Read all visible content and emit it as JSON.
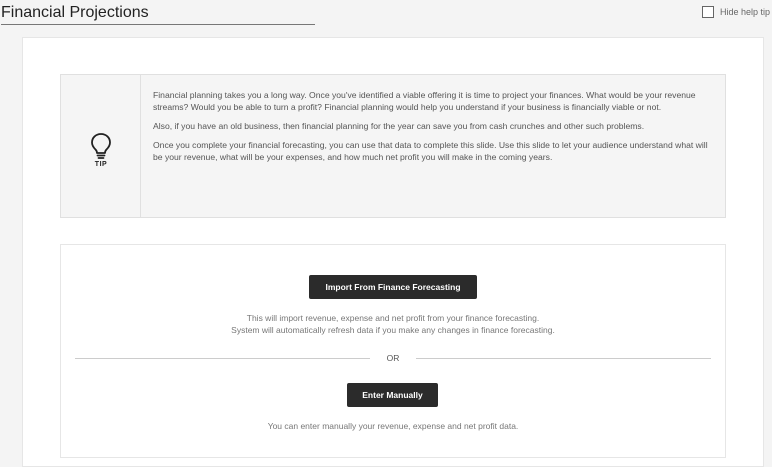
{
  "header": {
    "title": "Financial Projections",
    "help_toggle_label": "Hide help tip",
    "help_toggle_checked": false
  },
  "tip": {
    "label": "TIP",
    "icon": "lightbulb-icon",
    "paragraphs": [
      "Financial planning takes you a long way. Once you've identified a viable offering it is time to project your finances. What would be your revenue streams? Would you be able to turn a profit? Financial planning would help you understand if your business is financially viable or not.",
      "Also, if you have an old business, then financial planning for the year can save you from cash crunches and other such problems.",
      "Once you complete your financial forecasting, you can use that data to complete this slide. Use this slide to let your audience understand what will be your revenue, what will be your expenses, and how much net profit you will make in the coming years."
    ]
  },
  "import_section": {
    "import_button_label": "Import From Finance Forecasting",
    "import_description_line1": "This will import revenue, expense and net profit from your finance forecasting.",
    "import_description_line2": "System will automatically refresh data if you make any changes in finance forecasting.",
    "or_text": "OR",
    "manual_button_label": "Enter Manually",
    "manual_description": "You can enter manually your revenue, expense and net profit data."
  },
  "colors": {
    "button_bg": "#2b2b2b",
    "tip_bg": "#f5f5f5",
    "page_bg": "#f4f4f4"
  }
}
